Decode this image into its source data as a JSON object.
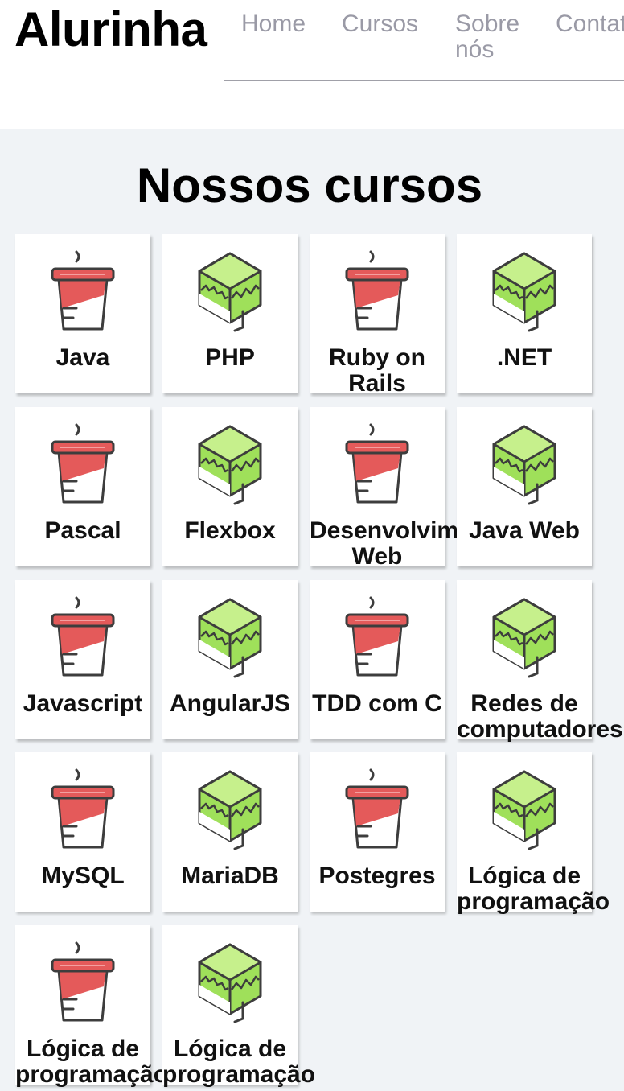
{
  "header": {
    "logo": "Alurinha",
    "nav": [
      {
        "label": "Home"
      },
      {
        "label": "Cursos"
      },
      {
        "label": "Sobre nós"
      },
      {
        "label": "Contato"
      }
    ]
  },
  "main": {
    "title": "Nossos cursos",
    "courses": [
      {
        "label": "Java",
        "icon": "coffee-cup-icon"
      },
      {
        "label": "PHP",
        "icon": "green-cube-icon"
      },
      {
        "label": "Ruby on Rails",
        "icon": "coffee-cup-icon"
      },
      {
        "label": ".NET",
        "icon": "green-cube-icon"
      },
      {
        "label": "Pascal",
        "icon": "coffee-cup-icon"
      },
      {
        "label": "Flexbox",
        "icon": "green-cube-icon"
      },
      {
        "label": "Desenvolvimento Web",
        "icon": "coffee-cup-icon"
      },
      {
        "label": "Java Web",
        "icon": "green-cube-icon"
      },
      {
        "label": "Javascript",
        "icon": "coffee-cup-icon"
      },
      {
        "label": "AngularJS",
        "icon": "green-cube-icon"
      },
      {
        "label": "TDD com C",
        "icon": "coffee-cup-icon"
      },
      {
        "label": "Redes de computadores",
        "icon": "green-cube-icon"
      },
      {
        "label": "MySQL",
        "icon": "coffee-cup-icon"
      },
      {
        "label": "MariaDB",
        "icon": "green-cube-icon"
      },
      {
        "label": "Postegres",
        "icon": "coffee-cup-icon"
      },
      {
        "label": "Lógica de programação",
        "icon": "green-cube-icon"
      },
      {
        "label": "Lógica de programação",
        "icon": "coffee-cup-icon"
      },
      {
        "label": "Lógica de programação",
        "icon": "green-cube-icon"
      }
    ]
  },
  "colors": {
    "background": "#f0f3f6",
    "nav_text": "#9a9aa6",
    "cup_red": "#e45a5a",
    "cube_green": "#9fe05a",
    "icon_stroke": "#3d3d3d"
  }
}
